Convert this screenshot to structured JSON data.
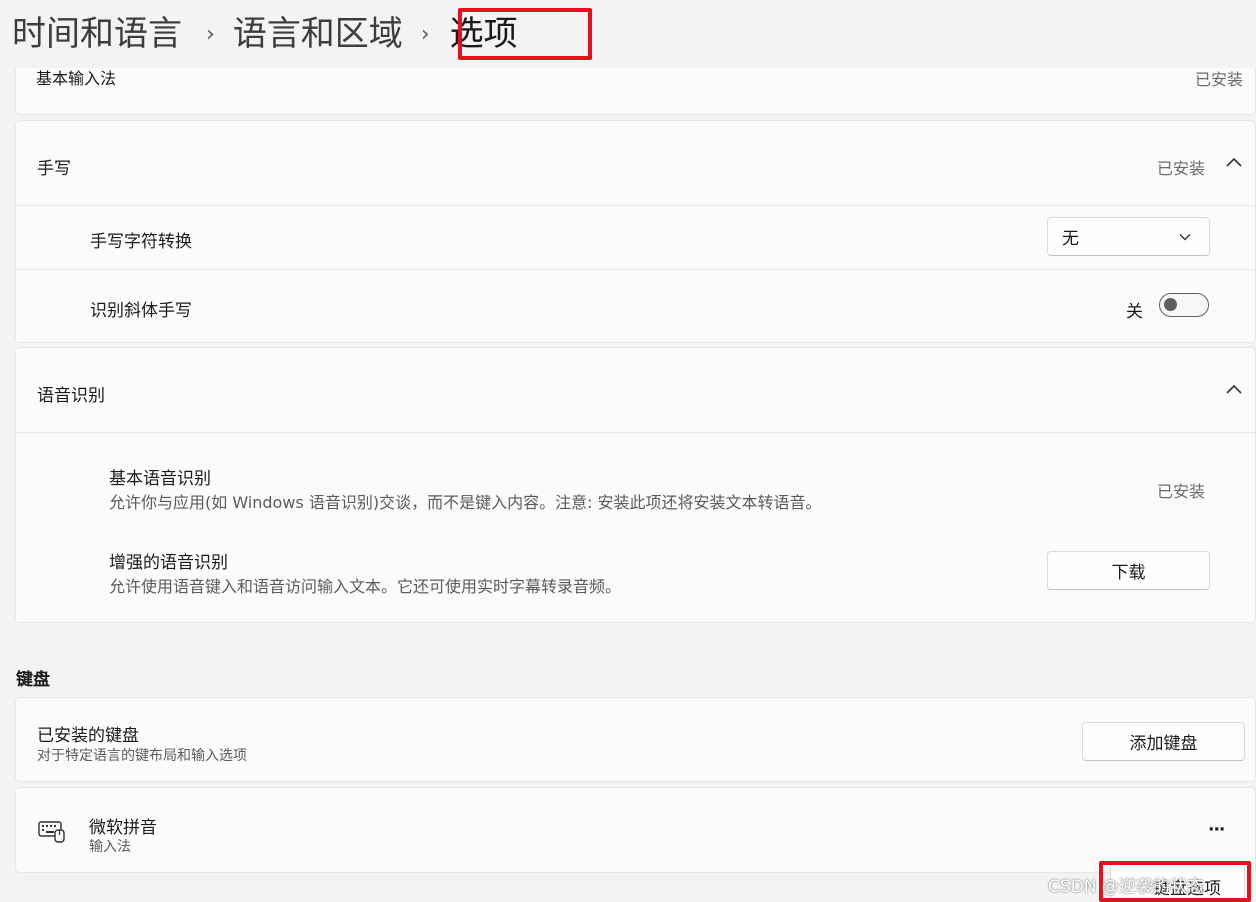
{
  "breadcrumb": {
    "item1": "时间和语言",
    "item2": "语言和区域",
    "current": "选项",
    "separator": "›"
  },
  "basic_input": {
    "label": "基本输入法",
    "status": "已安装"
  },
  "handwriting": {
    "title": "手写",
    "status": "已安装",
    "char_convert": {
      "label": "手写字符转换",
      "selected": "无"
    },
    "italic": {
      "label": "识别斜体手写",
      "state_text": "关",
      "on": false
    }
  },
  "speech": {
    "title": "语音识别",
    "basic": {
      "title": "基本语音识别",
      "desc": "允许你与应用(如 Windows 语音识别)交谈，而不是键入内容。注意: 安装此项还将安装文本转语音。",
      "status": "已安装"
    },
    "enhanced": {
      "title": "增强的语音识别",
      "desc": "允许使用语音键入和语音访问输入文本。它还可使用实时字幕转录音频。",
      "button": "下载"
    }
  },
  "keyboard": {
    "section_title": "键盘",
    "installed": {
      "title": "已安装的键盘",
      "desc": "对于特定语言的键布局和输入选项",
      "button": "添加键盘"
    },
    "ime": {
      "icon": "keyboard-icon",
      "name": "微软拼音",
      "type": "输入法",
      "more": "···"
    },
    "options_button": "键盘选项"
  },
  "watermark": "CSDN @逆袭的状态",
  "colors": {
    "highlight": "#e5101d",
    "background": "#f3f3f3",
    "card": "#fbfbfb"
  }
}
